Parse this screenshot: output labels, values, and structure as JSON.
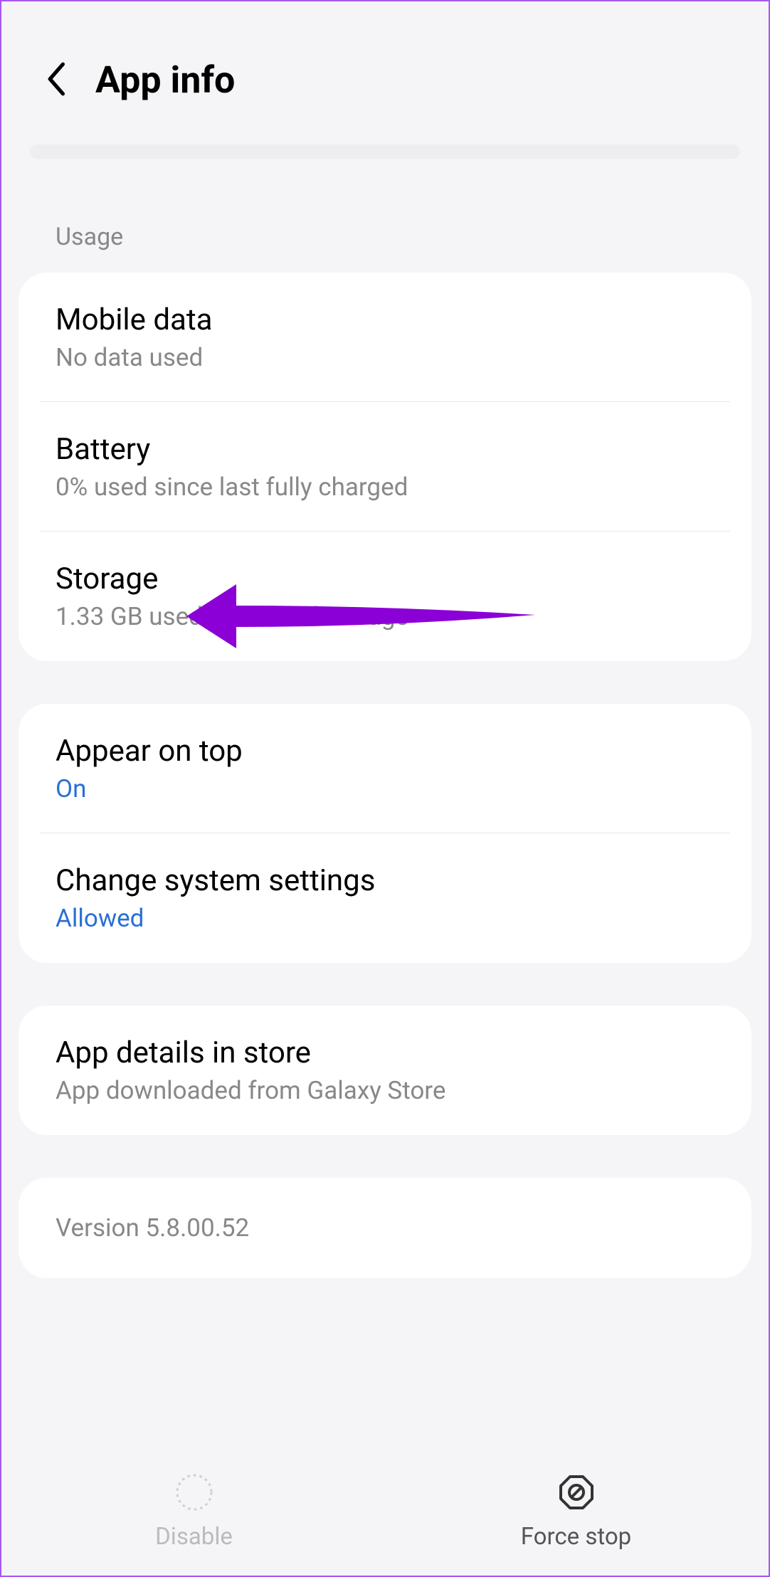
{
  "header": {
    "title": "App info"
  },
  "sections": {
    "usage": {
      "label": "Usage",
      "items": [
        {
          "title": "Mobile data",
          "subtitle": "No data used"
        },
        {
          "title": "Battery",
          "subtitle": "0% used since last fully charged"
        },
        {
          "title": "Storage",
          "subtitle": "1.33 GB used in Internal storage"
        }
      ]
    },
    "advanced": {
      "items": [
        {
          "title": "Appear on top",
          "subtitle": "On",
          "blue": true
        },
        {
          "title": "Change system settings",
          "subtitle": "Allowed",
          "blue": true
        }
      ]
    },
    "store": {
      "items": [
        {
          "title": "App details in store",
          "subtitle": "App downloaded from Galaxy Store"
        }
      ]
    }
  },
  "version": "Version 5.8.00.52",
  "bottomBar": {
    "disable": "Disable",
    "forceStop": "Force stop"
  }
}
